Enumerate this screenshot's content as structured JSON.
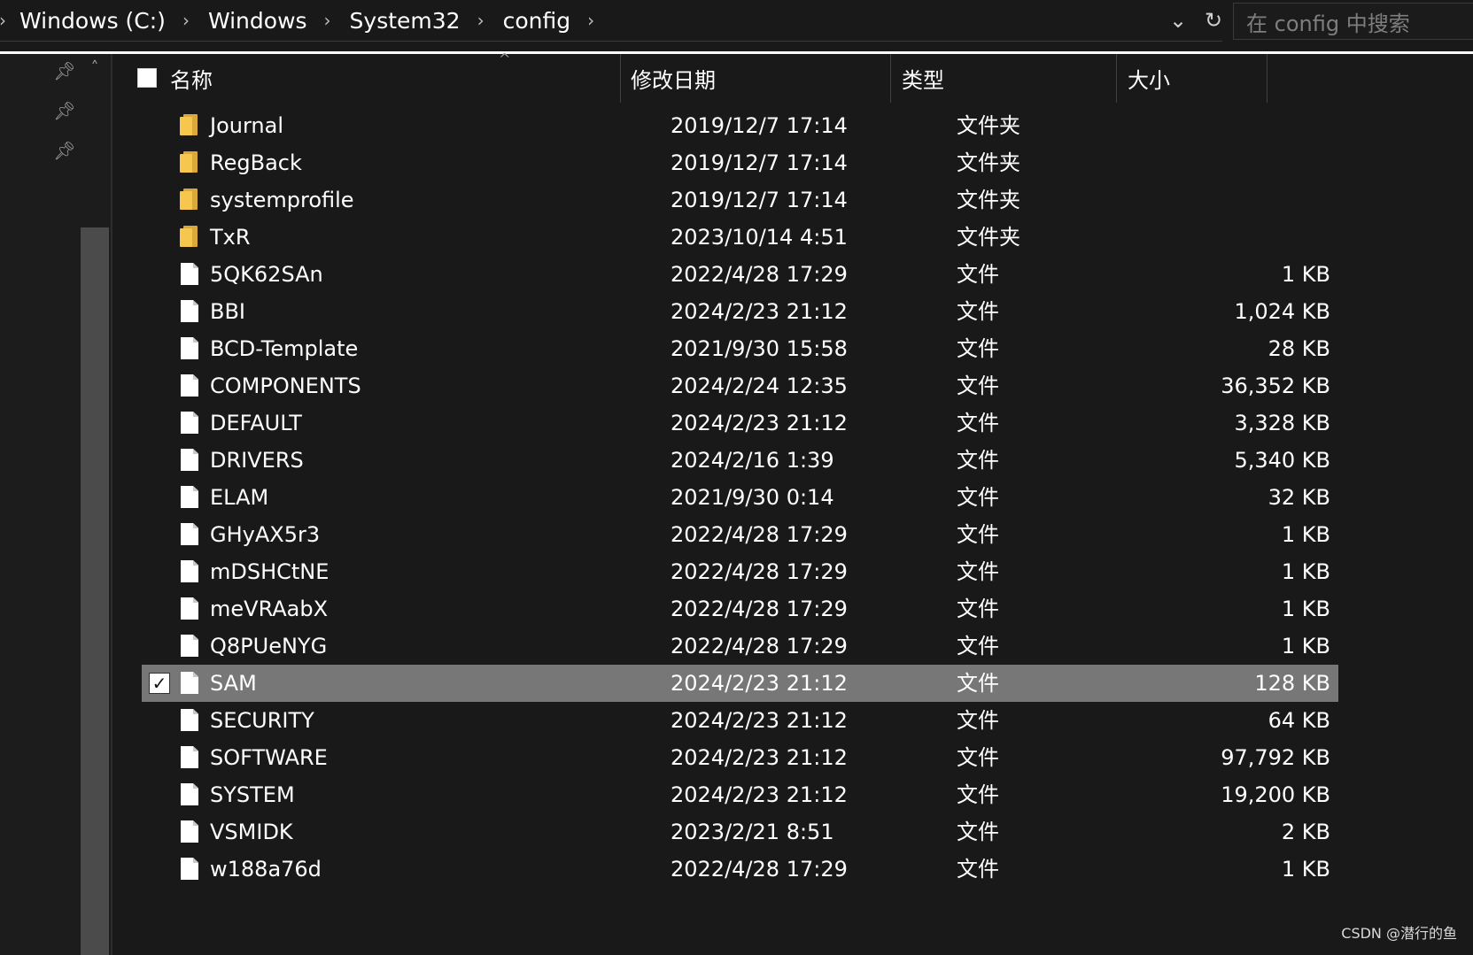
{
  "address_bar": {
    "breadcrumbs": [
      "Windows (C:)",
      "Windows",
      "System32",
      "config"
    ],
    "dropdown_icon": "chevron-down-icon",
    "refresh_icon": "refresh-icon",
    "search_placeholder": "在 config 中搜索"
  },
  "columns": {
    "name": "名称",
    "date": "修改日期",
    "type": "类型",
    "size": "大小"
  },
  "files": [
    {
      "name": "Journal",
      "date": "2019/12/7 17:14",
      "type": "文件夹",
      "size": "",
      "icon": "folder-icon",
      "selected": false
    },
    {
      "name": "RegBack",
      "date": "2019/12/7 17:14",
      "type": "文件夹",
      "size": "",
      "icon": "folder-icon",
      "selected": false
    },
    {
      "name": "systemprofile",
      "date": "2019/12/7 17:14",
      "type": "文件夹",
      "size": "",
      "icon": "folder-icon",
      "selected": false
    },
    {
      "name": "TxR",
      "date": "2023/10/14 4:51",
      "type": "文件夹",
      "size": "",
      "icon": "folder-icon",
      "selected": false
    },
    {
      "name": "5QK62SAn",
      "date": "2022/4/28 17:29",
      "type": "文件",
      "size": "1 KB",
      "icon": "file-icon",
      "selected": false
    },
    {
      "name": "BBI",
      "date": "2024/2/23 21:12",
      "type": "文件",
      "size": "1,024 KB",
      "icon": "file-icon",
      "selected": false
    },
    {
      "name": "BCD-Template",
      "date": "2021/9/30 15:58",
      "type": "文件",
      "size": "28 KB",
      "icon": "file-icon",
      "selected": false
    },
    {
      "name": "COMPONENTS",
      "date": "2024/2/24 12:35",
      "type": "文件",
      "size": "36,352 KB",
      "icon": "file-icon",
      "selected": false
    },
    {
      "name": "DEFAULT",
      "date": "2024/2/23 21:12",
      "type": "文件",
      "size": "3,328 KB",
      "icon": "file-icon",
      "selected": false
    },
    {
      "name": "DRIVERS",
      "date": "2024/2/16 1:39",
      "type": "文件",
      "size": "5,340 KB",
      "icon": "file-icon",
      "selected": false
    },
    {
      "name": "ELAM",
      "date": "2021/9/30 0:14",
      "type": "文件",
      "size": "32 KB",
      "icon": "file-icon",
      "selected": false
    },
    {
      "name": "GHyAX5r3",
      "date": "2022/4/28 17:29",
      "type": "文件",
      "size": "1 KB",
      "icon": "file-icon",
      "selected": false
    },
    {
      "name": "mDSHCtNE",
      "date": "2022/4/28 17:29",
      "type": "文件",
      "size": "1 KB",
      "icon": "file-icon",
      "selected": false
    },
    {
      "name": "meVRAabX",
      "date": "2022/4/28 17:29",
      "type": "文件",
      "size": "1 KB",
      "icon": "file-icon",
      "selected": false
    },
    {
      "name": "Q8PUeNYG",
      "date": "2022/4/28 17:29",
      "type": "文件",
      "size": "1 KB",
      "icon": "file-icon",
      "selected": false
    },
    {
      "name": "SAM",
      "date": "2024/2/23 21:12",
      "type": "文件",
      "size": "128 KB",
      "icon": "file-icon",
      "selected": true
    },
    {
      "name": "SECURITY",
      "date": "2024/2/23 21:12",
      "type": "文件",
      "size": "64 KB",
      "icon": "file-icon",
      "selected": false
    },
    {
      "name": "SOFTWARE",
      "date": "2024/2/23 21:12",
      "type": "文件",
      "size": "97,792 KB",
      "icon": "file-icon",
      "selected": false
    },
    {
      "name": "SYSTEM",
      "date": "2024/2/23 21:12",
      "type": "文件",
      "size": "19,200 KB",
      "icon": "file-icon",
      "selected": false
    },
    {
      "name": "VSMIDK",
      "date": "2023/2/21 8:51",
      "type": "文件",
      "size": "2 KB",
      "icon": "file-icon",
      "selected": false
    },
    {
      "name": "w188a76d",
      "date": "2022/4/28 17:29",
      "type": "文件",
      "size": "1 KB",
      "icon": "file-icon",
      "selected": false
    }
  ],
  "watermark": "CSDN @潜行的鱼",
  "colors": {
    "background": "#191919",
    "selection": "#777777",
    "folder": "#f6c64f",
    "text": "#ffffff",
    "placeholder": "#7e7e7e"
  }
}
